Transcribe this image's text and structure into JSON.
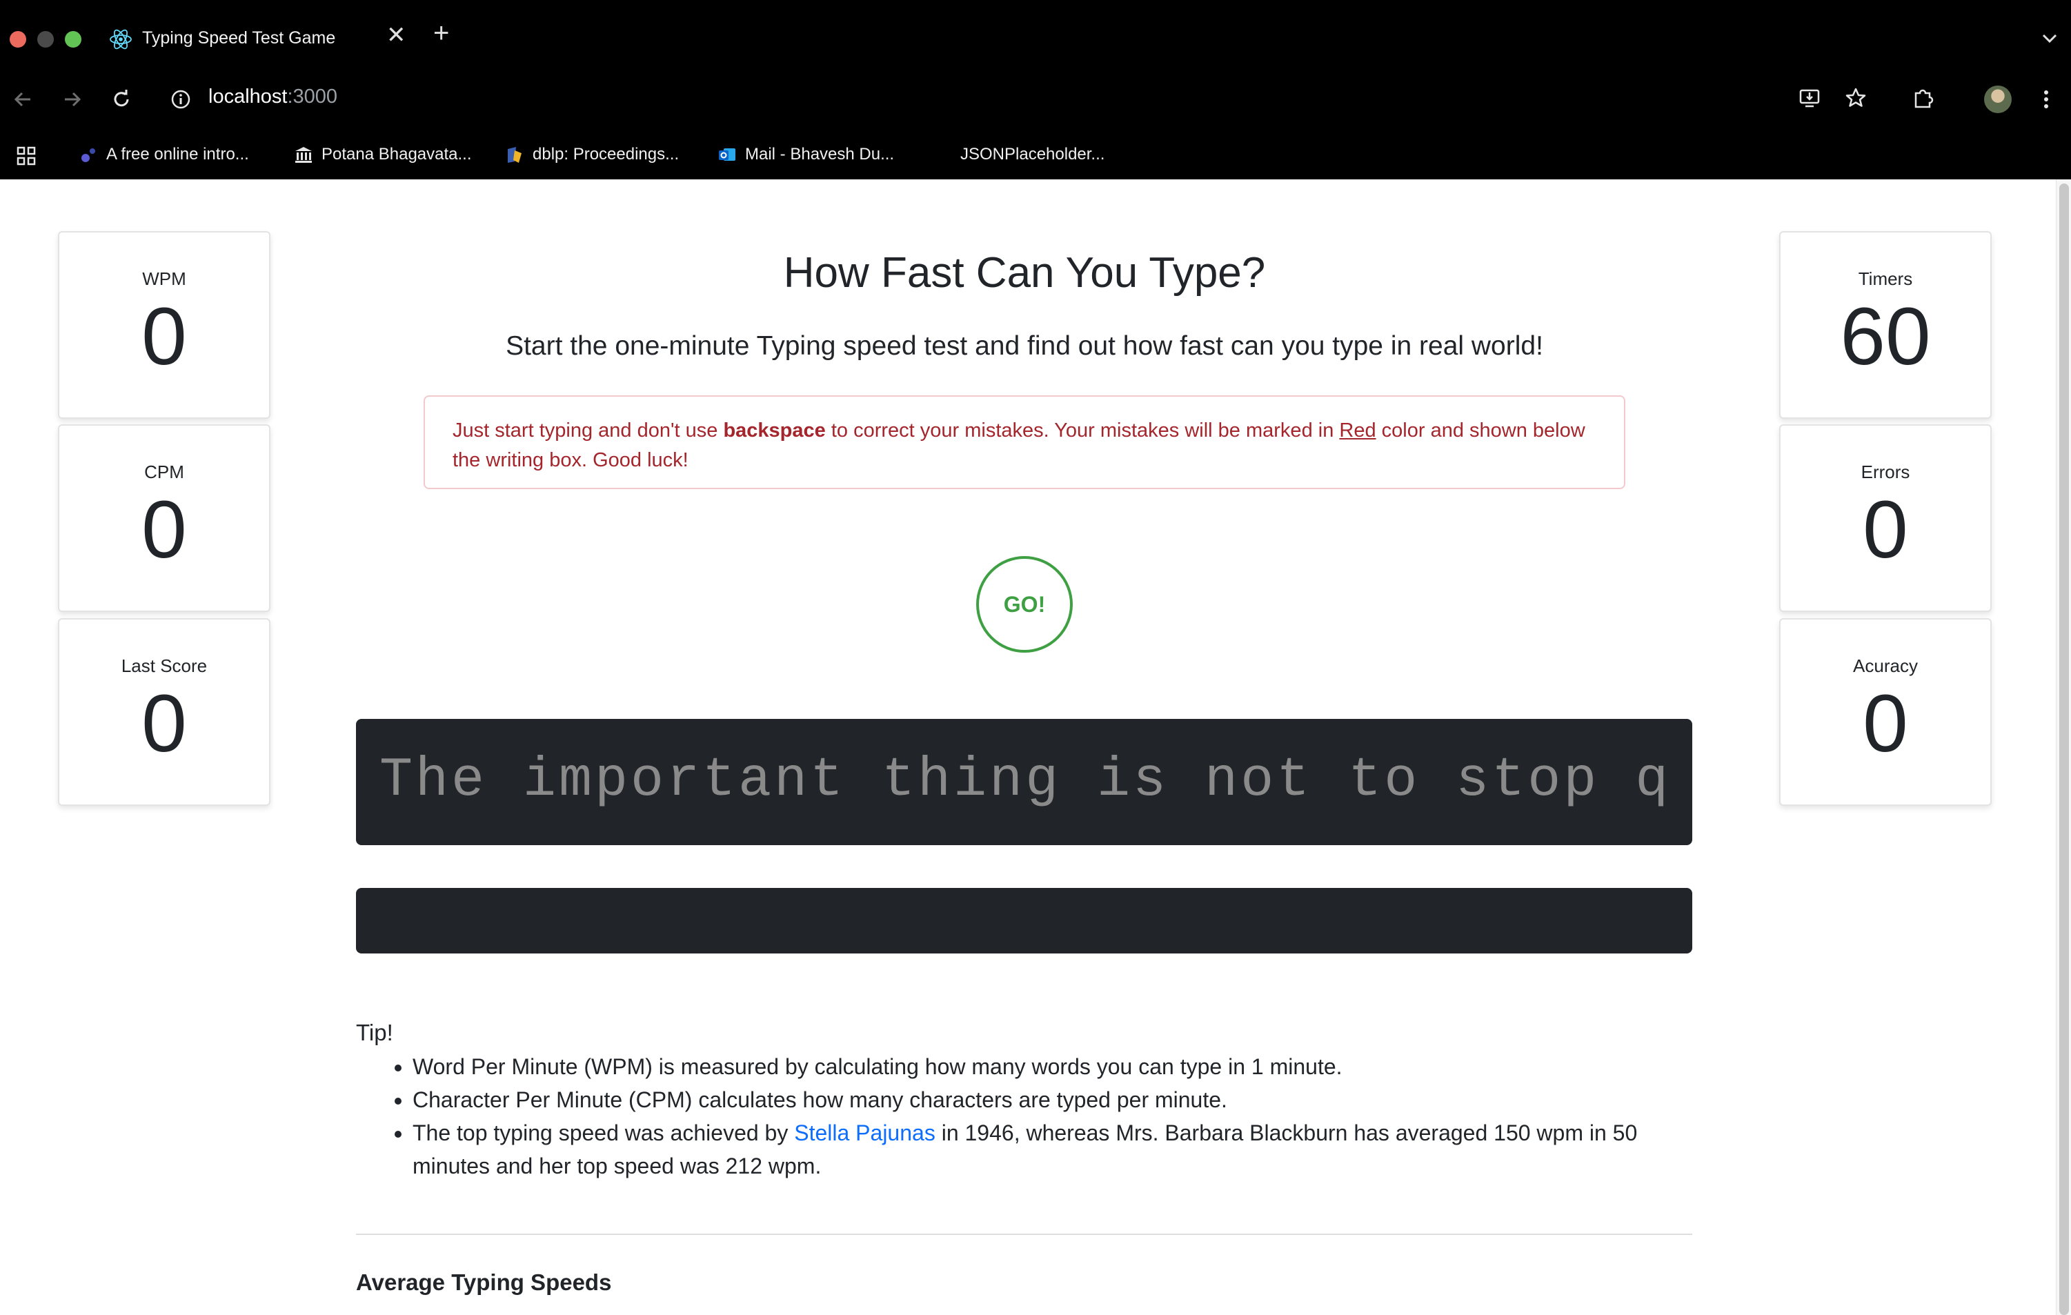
{
  "browser": {
    "tab_title": "Typing Speed Test Game",
    "tab_close": "✕",
    "new_tab": "+",
    "url_host": "localhost",
    "url_port": ":3000",
    "bookmarks": [
      {
        "label": "A free online intro..."
      },
      {
        "label": "Potana Bhagavata..."
      },
      {
        "label": "dblp: Proceedings..."
      },
      {
        "label": "Mail - Bhavesh Du..."
      },
      {
        "label": "JSONPlaceholder..."
      }
    ]
  },
  "stats_left": [
    {
      "label": "WPM",
      "value": "0"
    },
    {
      "label": "CPM",
      "value": "0"
    },
    {
      "label": "Last Score",
      "value": "0"
    }
  ],
  "stats_right": [
    {
      "label": "Timers",
      "value": "60"
    },
    {
      "label": "Errors",
      "value": "0"
    },
    {
      "label": "Acuracy",
      "value": "0"
    }
  ],
  "main": {
    "title": "How Fast Can You Type?",
    "subtitle": "Start the one-minute Typing speed test and find out how fast can you type in real world!",
    "alert": {
      "part1": "Just start typing and don't use ",
      "bold": "backspace",
      "part2": " to correct your mistakes. Your mistakes will be marked in ",
      "underlined": "Red",
      "part3": " color and shown below the writing box. Good luck!"
    },
    "go_label": "GO!",
    "quote": "The important thing is not to stop q",
    "input_value": ""
  },
  "tips": {
    "heading": "Tip!",
    "item1": "Word Per Minute (WPM) is measured by calculating how many words you can type in 1 minute.",
    "item2": "Character Per Minute (CPM) calculates how many characters are typed per minute.",
    "item3_before": "The top typing speed was achieved by ",
    "item3_link": "Stella Pajunas",
    "item3_after": " in 1946, whereas Mrs. Barbara Blackburn has averaged 150 wpm in 50 minutes and her top speed was 212 wpm."
  },
  "average": {
    "heading": "Average Typing Speeds"
  },
  "colors": {
    "accent_green": "#3ea043",
    "alert_red": "#a4262c",
    "link_blue": "#0d6efd",
    "dark_box": "#212529"
  },
  "icons": {
    "tab": "react-icon",
    "back": "back-arrow-icon",
    "forward": "forward-arrow-icon",
    "reload": "reload-icon",
    "site_info": "info-icon",
    "install": "install-app-icon",
    "bookmark": "star-icon",
    "extensions": "puzzle-icon",
    "menu": "kebab-menu-icon",
    "apps": "apps-grid-icon"
  }
}
